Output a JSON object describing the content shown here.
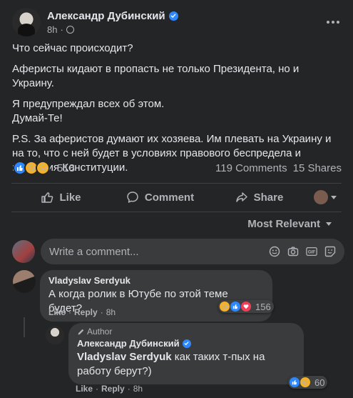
{
  "post": {
    "author": "Александр Дубинский",
    "time": "8h",
    "paragraphs": [
      "Что сейчас происходит?",
      "Аферисты кидают в пропасть не только Президента, но и Украину.",
      "Я предупреждал всех об этом.",
      "Думай-Те!",
      "P.S. За аферистов думают их хозяева. Им плевать на Украину и на то, что с ней будет в условиях правового беспредела и попрания Конституции."
    ]
  },
  "stats": {
    "reaction_count": "518",
    "comments": "119 Comments",
    "shares": "15 Shares"
  },
  "actions": {
    "like": "Like",
    "comment": "Comment",
    "share": "Share"
  },
  "sort_label": "Most Relevant",
  "composer": {
    "placeholder": "Write a comment..."
  },
  "comments": [
    {
      "name": "Vladyslav Serdyuk",
      "text": "А когда ролик в Ютубе по этой теме будет?",
      "like": "Like",
      "reply": "Reply",
      "time": "8h",
      "reactions": "156"
    }
  ],
  "reply": {
    "badge": "Author",
    "name": "Александр Дубинский",
    "mention": "Vladyslav Serdyuk",
    "text": " как таких т-пых на работу берут?)",
    "like": "Like",
    "reply": "Reply",
    "time": "8h",
    "reactions": "60"
  },
  "colors": {
    "background": "#242526",
    "bubble": "#3a3b3c",
    "accent": "#2d88ff",
    "secondary_text": "#b0b3b8"
  },
  "icons": [
    "verified-icon",
    "globe-icon",
    "more-icon",
    "like-icon",
    "comment-icon",
    "share-icon",
    "emoji-icon",
    "camera-icon",
    "gif-icon",
    "sticker-icon",
    "pencil-icon"
  ]
}
